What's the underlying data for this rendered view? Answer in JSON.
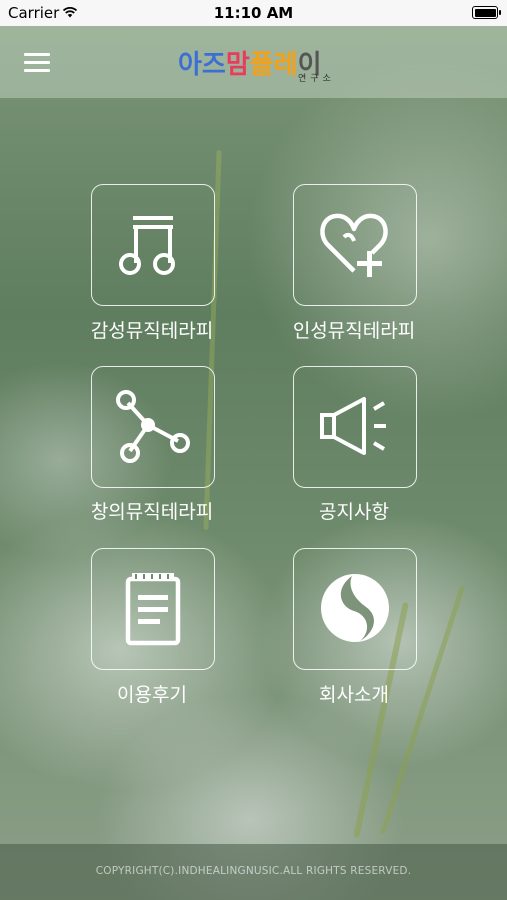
{
  "status_bar": {
    "carrier": "Carrier",
    "time": "11:10 AM"
  },
  "header": {
    "logo": {
      "text": "아즈맘플레이",
      "subtitle": "연구소",
      "colors": [
        "#3b6fd4",
        "#e83c5c",
        "#f2a21a",
        "#555555"
      ]
    },
    "menu_icon": "hamburger-menu-icon"
  },
  "menu": [
    {
      "label": "감성뮤직테라피",
      "icon": "music-note-icon"
    },
    {
      "label": "인성뮤직테라피",
      "icon": "heart-plus-icon"
    },
    {
      "label": "창의뮤직테라피",
      "icon": "network-nodes-icon"
    },
    {
      "label": "공지사항",
      "icon": "megaphone-icon"
    },
    {
      "label": "이용후기",
      "icon": "notepad-icon"
    },
    {
      "label": "회사소개",
      "icon": "company-logo-icon"
    }
  ],
  "footer": {
    "copyright": "COPYRIGHT(C).INDHEALINGNUSIC.ALL RIGHTS RESERVED."
  }
}
